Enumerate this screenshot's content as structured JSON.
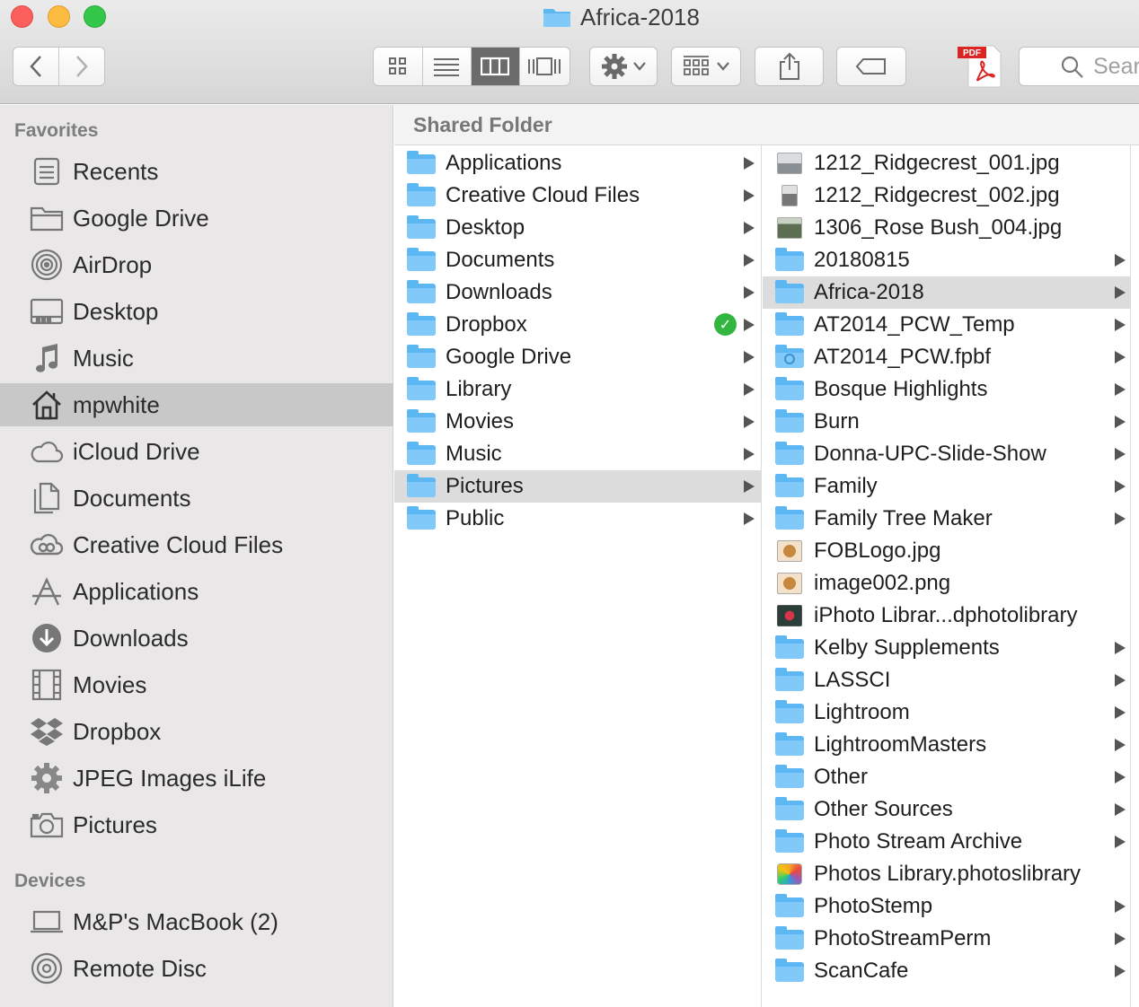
{
  "window": {
    "title": "Africa-2018"
  },
  "toolbar": {
    "search_placeholder": "Sear"
  },
  "sidebar": {
    "favorites_header": "Favorites",
    "favorites": [
      {
        "label": "Recents",
        "icon": "recents-icon"
      },
      {
        "label": "Google Drive",
        "icon": "folder-outline-icon"
      },
      {
        "label": "AirDrop",
        "icon": "airdrop-icon"
      },
      {
        "label": "Desktop",
        "icon": "desktop-icon"
      },
      {
        "label": "Music",
        "icon": "music-note-icon"
      },
      {
        "label": "mpwhite",
        "icon": "home-icon"
      },
      {
        "label": "iCloud Drive",
        "icon": "cloud-icon"
      },
      {
        "label": "Documents",
        "icon": "document-icon"
      },
      {
        "label": "Creative Cloud Files",
        "icon": "creative-cloud-icon"
      },
      {
        "label": "Applications",
        "icon": "applications-icon"
      },
      {
        "label": "Downloads",
        "icon": "download-icon"
      },
      {
        "label": "Movies",
        "icon": "film-icon"
      },
      {
        "label": "Dropbox",
        "icon": "dropbox-icon"
      },
      {
        "label": "JPEG Images iLife",
        "icon": "gear-icon"
      },
      {
        "label": "Pictures",
        "icon": "camera-icon"
      }
    ],
    "devices_header": "Devices",
    "devices": [
      {
        "label": "M&P's MacBook (2)",
        "icon": "laptop-icon"
      },
      {
        "label": "Remote Disc",
        "icon": "disc-icon"
      }
    ]
  },
  "path": {
    "title": "Shared Folder"
  },
  "column1": [
    {
      "label": "Applications"
    },
    {
      "label": "Creative Cloud Files"
    },
    {
      "label": "Desktop"
    },
    {
      "label": "Documents"
    },
    {
      "label": "Downloads"
    },
    {
      "label": "Dropbox"
    },
    {
      "label": "Google Drive"
    },
    {
      "label": "Library"
    },
    {
      "label": "Movies"
    },
    {
      "label": "Music"
    },
    {
      "label": "Pictures"
    },
    {
      "label": "Public"
    }
  ],
  "column2": [
    {
      "label": "1212_Ridgecrest_001.jpg"
    },
    {
      "label": "1212_Ridgecrest_002.jpg"
    },
    {
      "label": "1306_Rose Bush_004.jpg"
    },
    {
      "label": "20180815"
    },
    {
      "label": "Africa-2018"
    },
    {
      "label": "AT2014_PCW_Temp"
    },
    {
      "label": "AT2014_PCW.fpbf"
    },
    {
      "label": "Bosque Highlights"
    },
    {
      "label": "Burn"
    },
    {
      "label": "Donna-UPC-Slide-Show"
    },
    {
      "label": "Family"
    },
    {
      "label": "Family Tree Maker"
    },
    {
      "label": "FOBLogo.jpg"
    },
    {
      "label": "image002.png"
    },
    {
      "label": "iPhoto Librar...dphotolibrary"
    },
    {
      "label": "Kelby Supplements"
    },
    {
      "label": "LASSCI"
    },
    {
      "label": "Lightroom"
    },
    {
      "label": "LightroomMasters"
    },
    {
      "label": "Other"
    },
    {
      "label": "Other Sources"
    },
    {
      "label": "Photo Stream Archive"
    },
    {
      "label": "Photos Library.photoslibrary"
    },
    {
      "label": "PhotoStemp"
    },
    {
      "label": "PhotoStreamPerm"
    },
    {
      "label": "ScanCafe"
    }
  ]
}
